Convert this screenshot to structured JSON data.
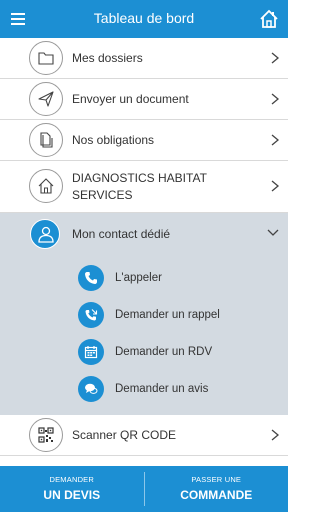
{
  "header": {
    "title": "Tableau de bord"
  },
  "menu": [
    {
      "label": "Mes dossiers",
      "icon": "folder-icon"
    },
    {
      "label": "Envoyer un document",
      "icon": "send-icon"
    },
    {
      "label": "Nos obligations",
      "icon": "documents-icon"
    },
    {
      "label_line1": "DIAGNOSTICS HABITAT",
      "label_line2": "SERVICES",
      "icon": "house-icon"
    }
  ],
  "contact": {
    "label": "Mon contact dédié",
    "icon": "user-icon",
    "actions": [
      {
        "label": "L'appeler",
        "icon": "phone-icon"
      },
      {
        "label": "Demander un rappel",
        "icon": "callback-icon"
      },
      {
        "label": "Demander un RDV",
        "icon": "calendar-icon"
      },
      {
        "label": "Demander un avis",
        "icon": "chat-icon"
      }
    ]
  },
  "scanner": {
    "label": "Scanner QR CODE",
    "icon": "qr-code-icon"
  },
  "footer": {
    "left": {
      "small": "DEMANDER",
      "big": "UN DEVIS"
    },
    "right": {
      "small": "PASSER UNE",
      "big": "COMMANDE"
    }
  },
  "colors": {
    "primary": "#1c8fd3",
    "panel": "#d3dae1",
    "text": "#333333"
  }
}
